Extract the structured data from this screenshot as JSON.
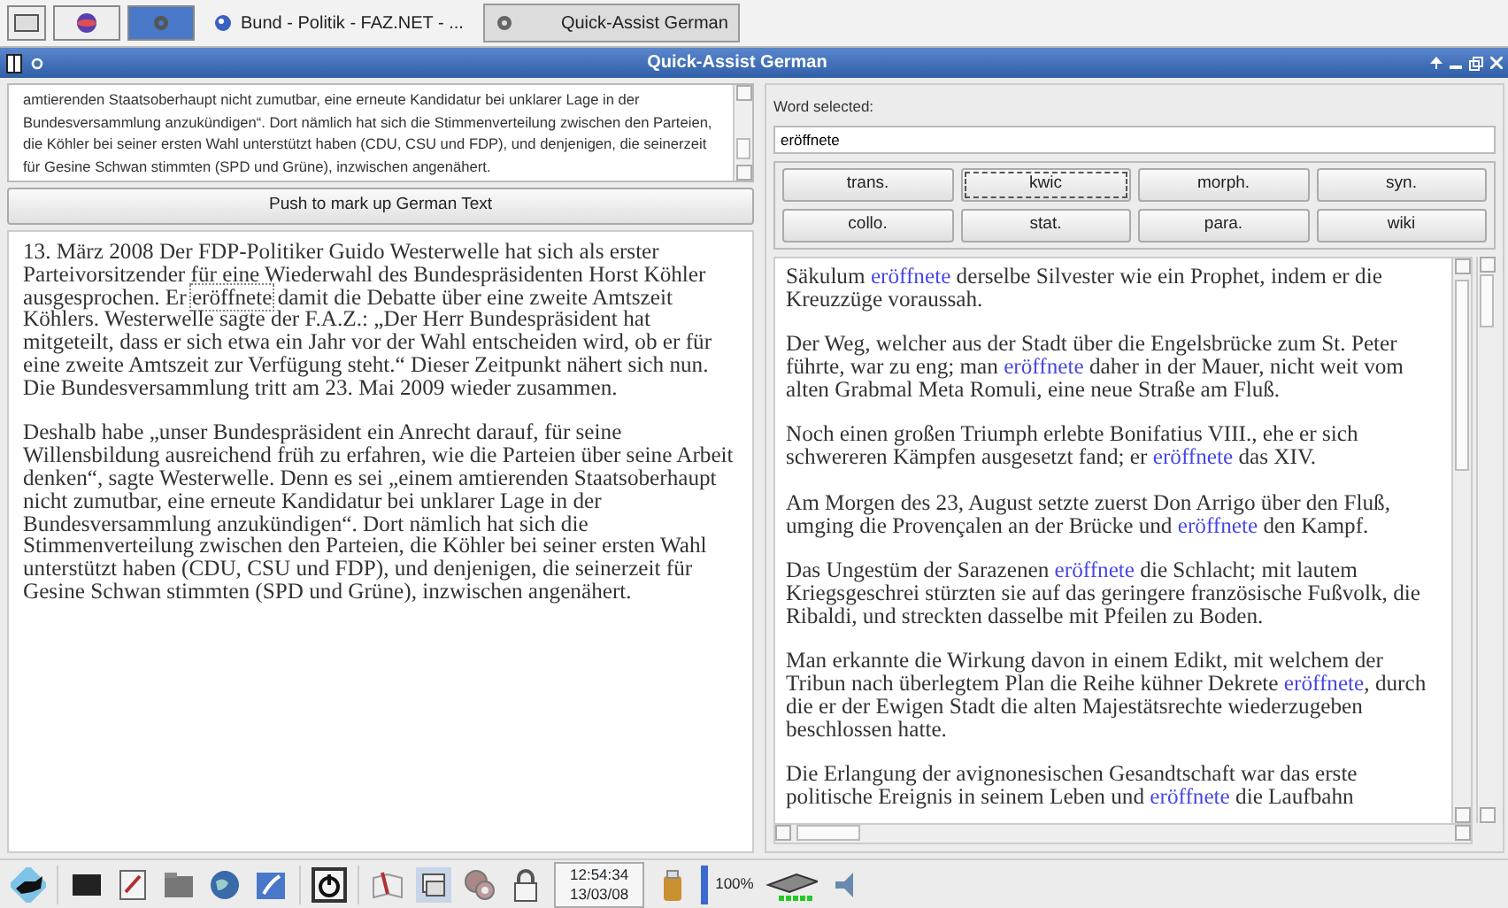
{
  "top_taskbar": {
    "tasks": [
      {
        "label": "Bund - Politik - FAZ.NET - ...",
        "selected": false
      },
      {
        "label": "Quick-Assist German",
        "selected": true
      }
    ]
  },
  "window": {
    "title": "Quick-Assist German"
  },
  "input_panel": {
    "source_text": "amtierenden Staatsoberhaupt nicht zumutbar, eine erneute Kandidatur bei unklarer Lage in der Bundesversammlung anzukündigen“. Dort nämlich hat sich die Stimmenverteilung zwischen den Parteien, die Köhler bei seiner ersten Wahl unterstützt haben (CDU, CSU und FDP), und denjenigen, die seinerzeit für Gesine Schwan stimmten (SPD und Grüne), inzwischen angenähert.",
    "mark_up_button": "Push to mark up German Text",
    "marked_text": [
      [
        {
          "text": "13. März 2008 Der FDP-Politiker Guido Westerwelle hat sich als erster Parteivorsitzender für eine Wiederwahl des Bundespräsidenten Horst Köhler ausgesprochen. Er ",
          "selected": false
        },
        {
          "text": "eröffnete",
          "selected": true
        },
        {
          "text": " damit die Debatte über eine zweite Amtszeit Köhlers. Westerwelle sagte der F.A.Z.: „Der Herr Bundespräsident hat mitgeteilt, dass er sich etwa ein Jahr vor der Wahl entscheiden wird, ob er für eine zweite Amtszeit zur Verfügung steht.“ Dieser Zeitpunkt nähert sich nun. Die Bundesversammlung tritt am 23. Mai 2009 wieder zusammen.",
          "selected": false
        }
      ],
      [
        {
          "text": "Deshalb habe „unser Bundespräsident ein Anrecht darauf, für seine Willensbildung ausreichend früh zu erfahren, wie die Parteien über seine Arbeit denken“, sagte Westerwelle. Denn es sei „einem amtierenden Staatsoberhaupt nicht zumutbar, eine erneute Kandidatur bei unklarer Lage in der Bundesversammlung anzukündigen“. Dort nämlich hat sich die Stimmenverteilung zwischen den Parteien, die Köhler bei seiner ersten Wahl unterstützt haben (CDU, CSU und FDP), und denjenigen, die seinerzeit für Gesine Schwan stimmten (SPD und Grüne), inzwischen angenähert.",
          "selected": false
        }
      ]
    ]
  },
  "word_panel": {
    "label": "Word selected:",
    "word": "eröffnete",
    "tools": [
      {
        "label": "trans.",
        "selected": false
      },
      {
        "label": "kwic",
        "selected": true
      },
      {
        "label": "morph.",
        "selected": false
      },
      {
        "label": "syn.",
        "selected": false
      },
      {
        "label": "collo.",
        "selected": false
      },
      {
        "label": "stat.",
        "selected": false
      },
      {
        "label": "para.",
        "selected": false
      },
      {
        "label": "wiki",
        "selected": false
      }
    ],
    "results": [
      {
        "before": "Säkulum ",
        "match": "eröffnete",
        "after": " derselbe Silvester wie ein Prophet, indem er die Kreuzzüge voraussah."
      },
      {
        "before": "Der Weg, welcher aus der Stadt über die Engelsbrücke zum St. Peter führte, war zu eng; man ",
        "match": "eröffnete",
        "after": " daher in der Mauer, nicht weit vom alten Grabmal Meta Romuli, eine neue Straße am Fluß."
      },
      {
        "before": "Noch einen großen Triumph erlebte Bonifatius VIII., ehe er sich schwereren Kämpfen ausgesetzt fand; er ",
        "match": "eröffnete",
        "after": " das XIV."
      },
      {
        "before": "Am Morgen des 23, August setzte zuerst Don Arrigo über den Fluß, umging die Provençalen an der Brücke und ",
        "match": "eröffnete",
        "after": " den Kampf."
      },
      {
        "before": "Das Ungestüm der Sarazenen ",
        "match": "eröffnete",
        "after": " die Schlacht; mit lautem Kriegsgeschrei stürzten sie auf das geringere französische Fußvolk, die Ribaldi, und streckten dasselbe mit Pfeilen zu Boden."
      },
      {
        "before": "Man erkannte die Wirkung davon in einem Edikt, mit welchem der Tribun nach überlegtem Plan die Reihe kühner Dekrete ",
        "match": "eröffnete",
        "after": ", durch die er der Ewigen Stadt die alten Majestätsrechte wiederzugeben beschlossen hatte."
      },
      {
        "before": "Die Erlangung der avignonesischen Gesandtschaft war das erste politische Ereignis in seinem Leben und ",
        "match": "eröffnete",
        "after": " die Laufbahn"
      }
    ]
  },
  "bottom_taskbar": {
    "clock_time": "12:54:34",
    "clock_date": "13/03/08",
    "battery": "100%"
  }
}
